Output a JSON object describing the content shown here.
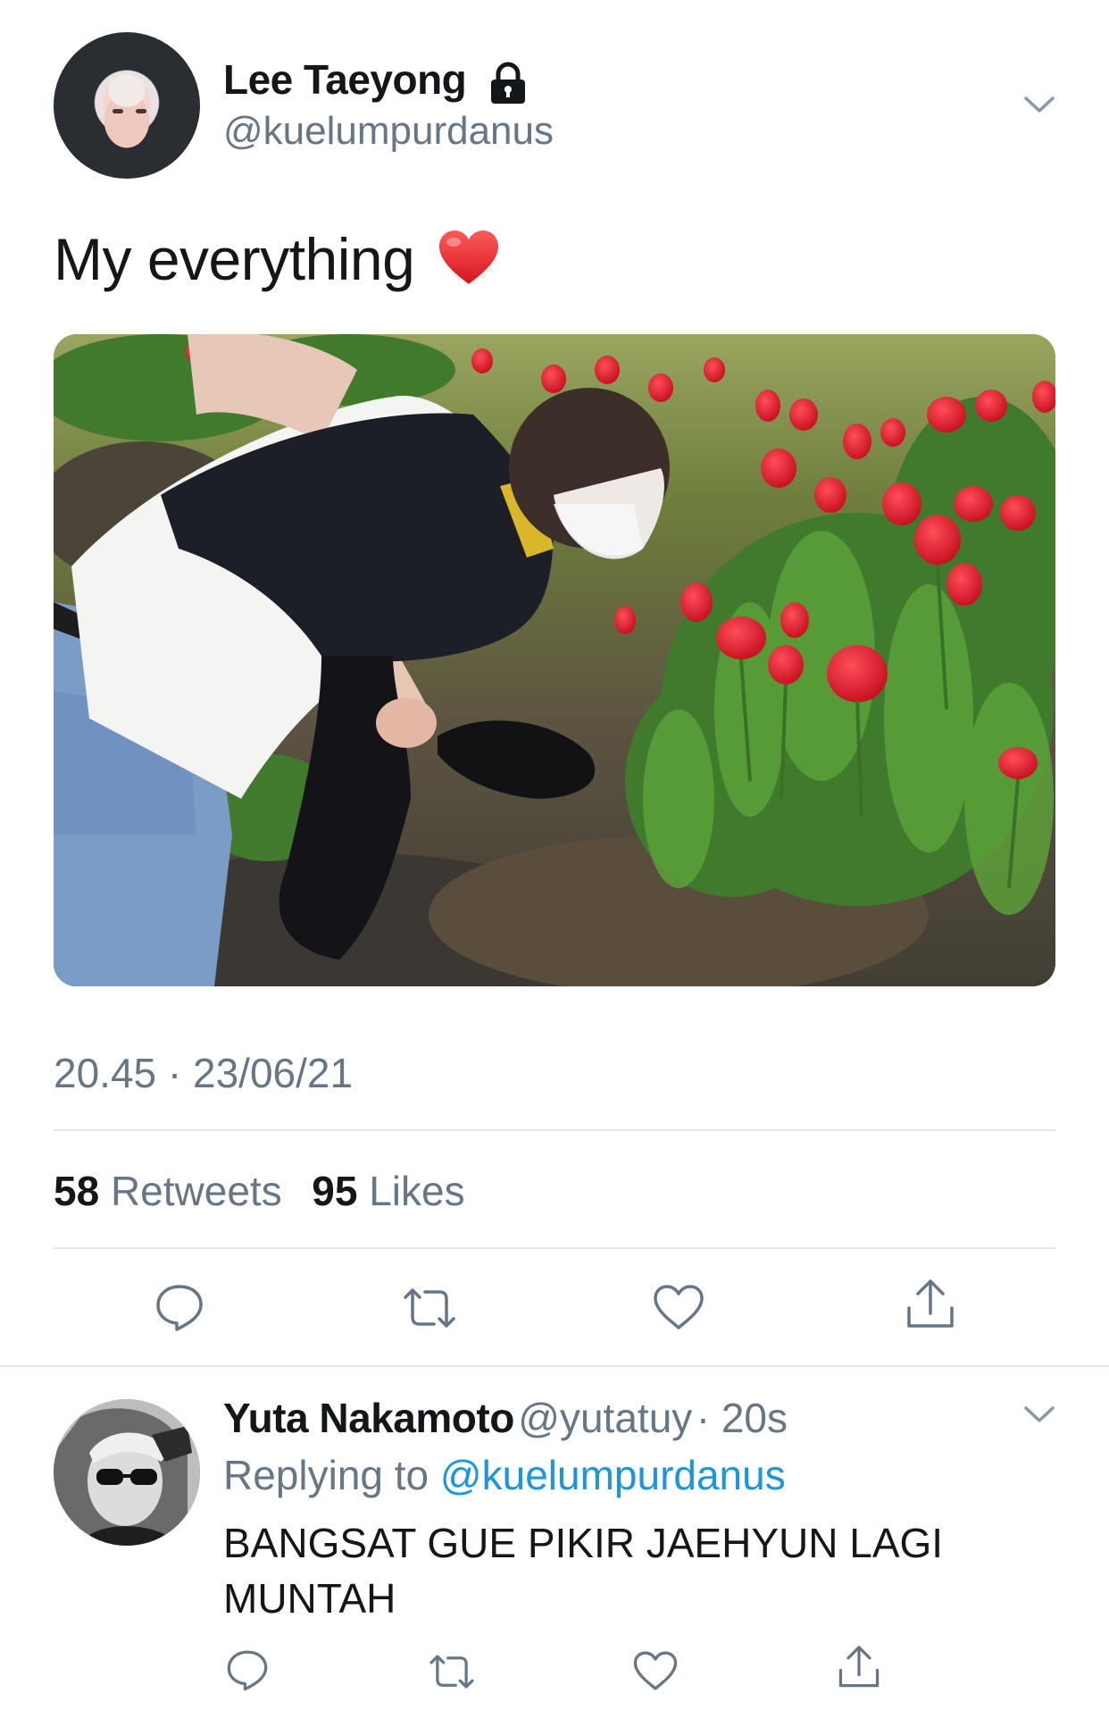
{
  "tweet": {
    "author": {
      "display_name": "Lee Taeyong",
      "handle": "@kuelumpurdanus",
      "protected_icon": "lock-icon"
    },
    "text": "My everything",
    "emoji": "❤️",
    "timestamp": "20.45 · 23/06/21",
    "stats": {
      "retweets_count": "58",
      "retweets_label": "Retweets",
      "likes_count": "95",
      "likes_label": "Likes"
    },
    "actions": [
      "reply-icon",
      "retweet-icon",
      "like-icon",
      "share-icon"
    ]
  },
  "reply": {
    "author": {
      "display_name": "Yuta Nakamoto",
      "handle": "@yutatuy",
      "time": "· 20s"
    },
    "replying_prefix": "Replying to",
    "replying_to": "@kuelumpurdanus",
    "text": "BANGSAT GUE PIKIR JAEHYUN LAGI MUNTAH",
    "actions": [
      "reply-icon",
      "retweet-icon",
      "like-icon",
      "share-icon"
    ]
  },
  "colors": {
    "text_primary": "#14171a",
    "text_secondary": "#657786",
    "link": "#1b95e0",
    "divider": "#e1e8ed",
    "heart": "#e0242c"
  }
}
